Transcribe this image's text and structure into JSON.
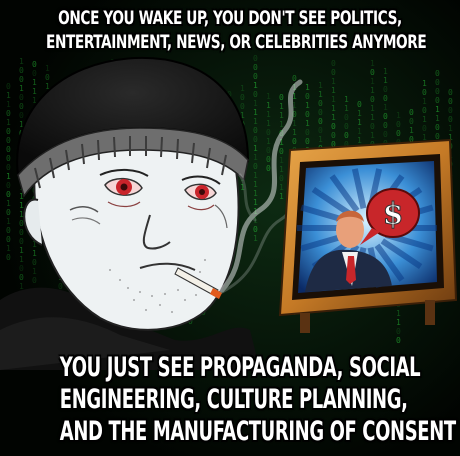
{
  "top_caption": {
    "line1": "ONCE YOU WAKE UP, YOU DON'T SEE POLITICS,",
    "line2": "ENTERTAINMENT, NEWS, OR CELEBRITIES ANYMORE"
  },
  "bottom_caption": {
    "line1": "YOU JUST SEE PROPAGANDA, SOCIAL",
    "line2": "ENGINEERING, CULTURE PLANNING,",
    "line3": "AND THE MANUFACTURING OF CONSENT"
  },
  "tv_symbol": "$",
  "colors": {
    "matrix_green": "#2bd63c",
    "tv_frame": "#c57a26",
    "money_bubble": "#c8262a"
  }
}
